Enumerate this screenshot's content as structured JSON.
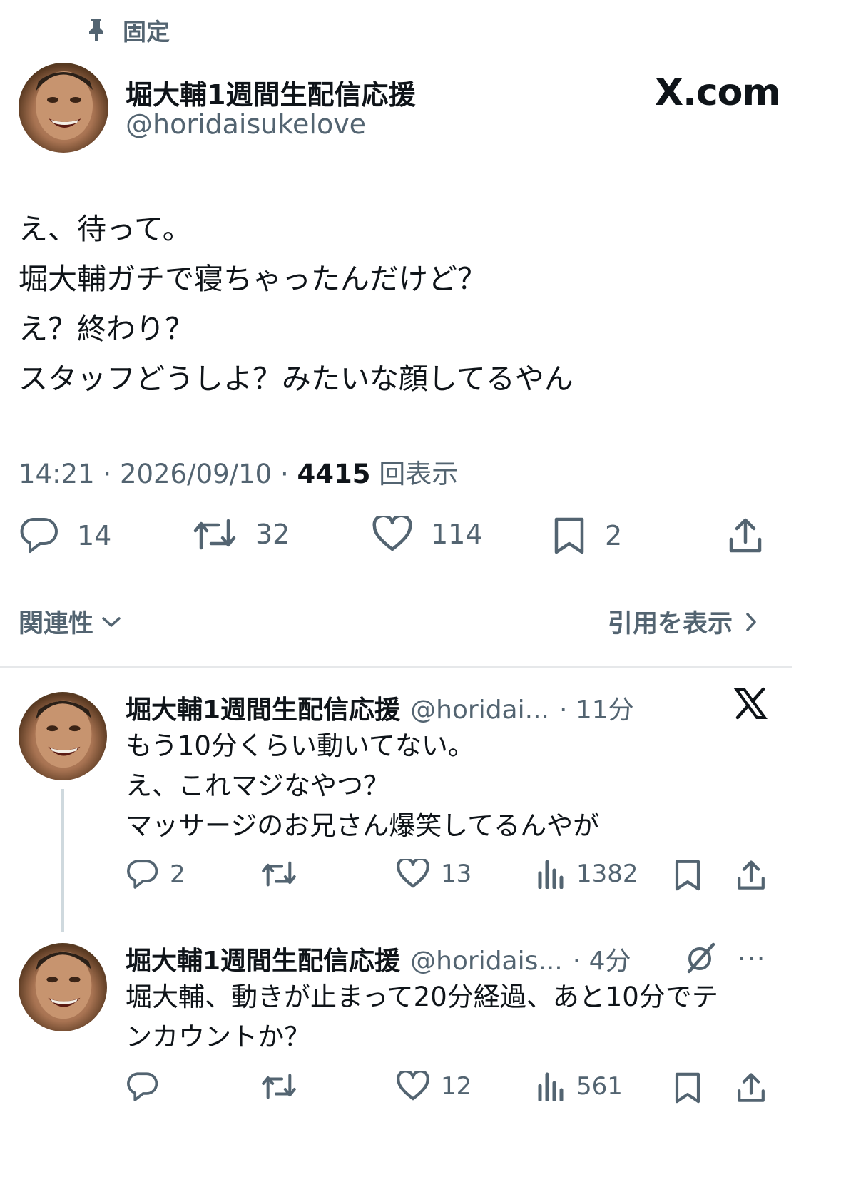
{
  "pinned": {
    "icon": "pin-icon",
    "label": "固定"
  },
  "main_post": {
    "display_name": "堀大輔1週間生配信応援",
    "handle": "@horidaisukelove",
    "watermark": "X.com",
    "text_lines": [
      "え、待って。",
      "堀大輔ガチで寝ちゃったんだけど？",
      "え？終わり？",
      "スタッフどうしよ？みたいな顔してるやん"
    ],
    "time": "14:21",
    "date": "2026/09/10",
    "views_count": "4415",
    "views_label": "回表示",
    "replies": "14",
    "reposts": "32",
    "likes": "114",
    "bookmarks": "2"
  },
  "sort_bar": {
    "sort_label": "関連性",
    "quotes_label": "引用を表示"
  },
  "replies": [
    {
      "display_name": "堀大輔1週間生配信応援",
      "handle": "@horidai...",
      "time": "· 11分",
      "text_lines": [
        "もう10分くらい動いてない。",
        "え、これマジなやつ？",
        "マッサージのお兄さん爆笑してるんやが"
      ],
      "replies": "2",
      "reposts": "",
      "likes": "13",
      "views": "1382"
    },
    {
      "display_name": "堀大輔1週間生配信応援",
      "handle": "@horidais...",
      "time": "· 4分",
      "more": "···",
      "text_lines": [
        "堀大輔、動きが止まって20分経過、あと10分でテ",
        "ンカウントか？"
      ],
      "replies": "",
      "reposts": "",
      "likes": "12",
      "views": "561"
    }
  ],
  "colors": {
    "text": "#0f1419",
    "secondary": "#536471",
    "divider": "#e6e8ea",
    "thread": "#cfd9de"
  }
}
